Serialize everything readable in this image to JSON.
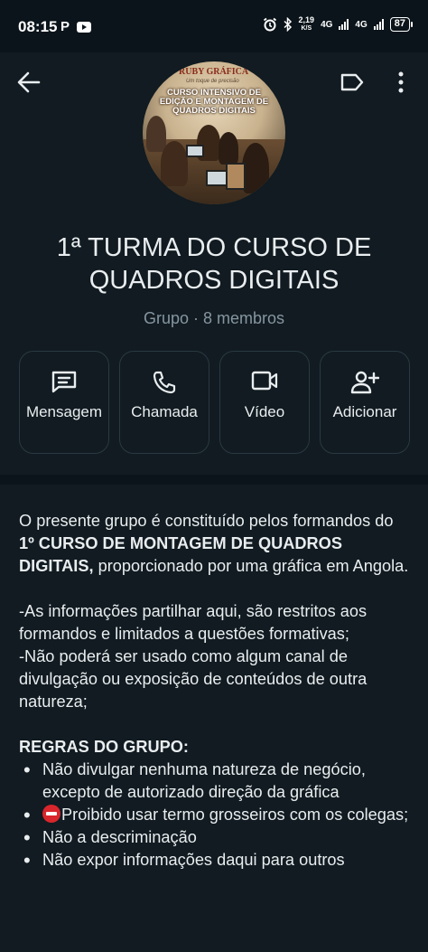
{
  "status_bar": {
    "time": "08:15",
    "left_icons": [
      "p-notification-icon",
      "youtube-icon"
    ],
    "right_icons": [
      "alarm-icon",
      "bluetooth-icon"
    ],
    "network_speed_value": "2,19",
    "network_speed_unit": "K/S",
    "network_1": "4G",
    "network_2": "4G",
    "battery": "87"
  },
  "header": {
    "back_icon": "arrow-left-icon",
    "label_icon": "label-tag-icon",
    "more_icon": "more-vertical-icon"
  },
  "avatar": {
    "brand": "RUBY GRÁFICA",
    "tagline": "Um toque de precisão",
    "title": "CURSO INTENSIVO DE EDIÇÃO E MONTAGEM DE QUADROS DIGITAIS"
  },
  "group": {
    "title": "1ª TURMA DO CURSO DE QUADROS DIGITAIS",
    "subtitle": "Grupo · 8 membros"
  },
  "actions": [
    {
      "label": "Mensagem",
      "icon": "message-icon"
    },
    {
      "label": "Chamada",
      "icon": "phone-icon"
    },
    {
      "label": "Vídeo",
      "icon": "video-icon"
    },
    {
      "label": "Adicionar",
      "icon": "add-person-icon"
    }
  ],
  "description": {
    "intro_1": "O presente grupo é constituído pelos formandos do ",
    "intro_bold": "1º CURSO DE MONTAGEM DE QUADROS DIGITAIS,",
    "intro_2": " proporcionado por uma gráfica em Angola.",
    "line_1": "-As informações partilhar aqui, são restritos aos formandos e limitados a questões formativas;",
    "line_2": "-Não poderá ser usado como algum canal de divulgação ou exposição de conteúdos de outra natureza;",
    "rules_heading": "REGRAS DO GRUPO:",
    "rules": [
      "Não divulgar nenhuma natureza de negócio, excepto de autorizado direção da gráfica",
      "Proibido usar termo grosseiros com os colegas;",
      "Não a descriminação",
      "Não expor informações daqui para outros"
    ]
  },
  "colors": {
    "background": "#0b141a",
    "card": "#111b21",
    "text_primary": "#e9edef",
    "text_secondary": "#8696a0",
    "button_border": "#2a3942",
    "no_entry_red": "#d9262c"
  }
}
